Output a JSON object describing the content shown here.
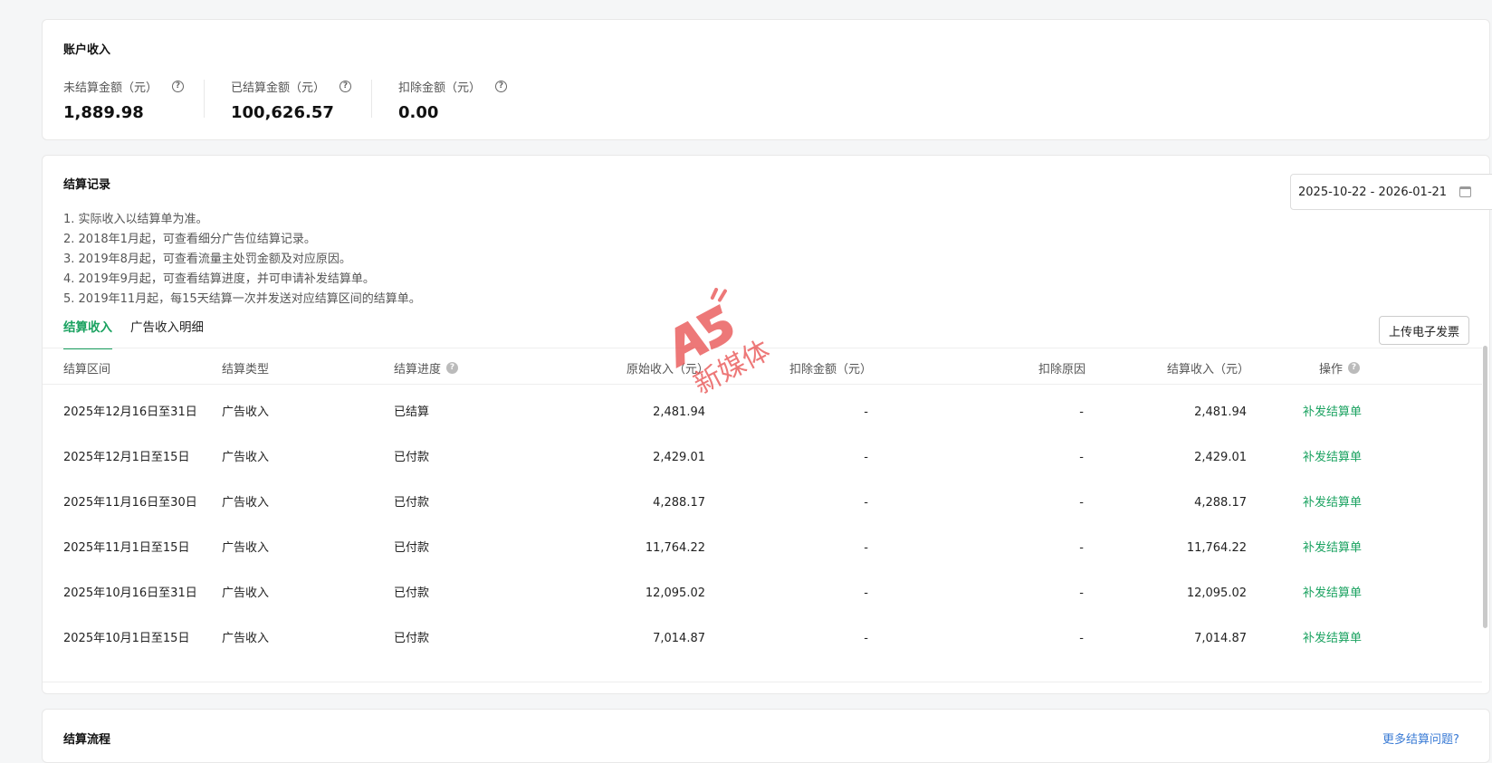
{
  "account": {
    "title": "账户收入",
    "stats": [
      {
        "label": "未结算金额（元）",
        "value": "1,889.98"
      },
      {
        "label": "已结算金额（元）",
        "value": "100,626.57"
      },
      {
        "label": "扣除金额（元）",
        "value": "0.00"
      }
    ]
  },
  "records": {
    "title": "结算记录",
    "date_range": "2025-10-22 - 2026-01-21",
    "notes": [
      "1. 实际收入以结算单为准。",
      "2. 2018年1月起，可查看细分广告位结算记录。",
      "3. 2019年8月起，可查看流量主处罚金额及对应原因。",
      "4. 2019年9月起，可查看结算进度，并可申请补发结算单。",
      "5. 2019年11月起，每15天结算一次并发送对应结算区间的结算单。"
    ],
    "tabs": [
      "结算收入",
      "广告收入明细"
    ],
    "upload_button": "上传电子发票",
    "columns": [
      "结算区间",
      "结算类型",
      "结算进度",
      "原始收入（元）",
      "扣除金额（元）",
      "扣除原因",
      "结算收入（元）",
      "操作"
    ],
    "rows": [
      {
        "period": "2025年12月16日至31日",
        "type": "广告收入",
        "progress": "已结算",
        "original": "2,481.94",
        "deduction": "-",
        "reason": "-",
        "income": "2,481.94",
        "action": "补发结算单"
      },
      {
        "period": "2025年12月1日至15日",
        "type": "广告收入",
        "progress": "已付款",
        "original": "2,429.01",
        "deduction": "-",
        "reason": "-",
        "income": "2,429.01",
        "action": "补发结算单"
      },
      {
        "period": "2025年11月16日至30日",
        "type": "广告收入",
        "progress": "已付款",
        "original": "4,288.17",
        "deduction": "-",
        "reason": "-",
        "income": "4,288.17",
        "action": "补发结算单"
      },
      {
        "period": "2025年11月1日至15日",
        "type": "广告收入",
        "progress": "已付款",
        "original": "11,764.22",
        "deduction": "-",
        "reason": "-",
        "income": "11,764.22",
        "action": "补发结算单"
      },
      {
        "period": "2025年10月16日至31日",
        "type": "广告收入",
        "progress": "已付款",
        "original": "12,095.02",
        "deduction": "-",
        "reason": "-",
        "income": "12,095.02",
        "action": "补发结算单"
      },
      {
        "period": "2025年10月1日至15日",
        "type": "广告收入",
        "progress": "已付款",
        "original": "7,014.87",
        "deduction": "-",
        "reason": "-",
        "income": "7,014.87",
        "action": "补发结算单"
      }
    ]
  },
  "flow": {
    "title": "结算流程",
    "more_link": "更多结算问题?"
  },
  "watermark": {
    "logo": "A5",
    "text": "新媒体"
  },
  "colors": {
    "accent": "#1aa260",
    "link": "#3a7bd5",
    "watermark": "#e84c4c"
  }
}
